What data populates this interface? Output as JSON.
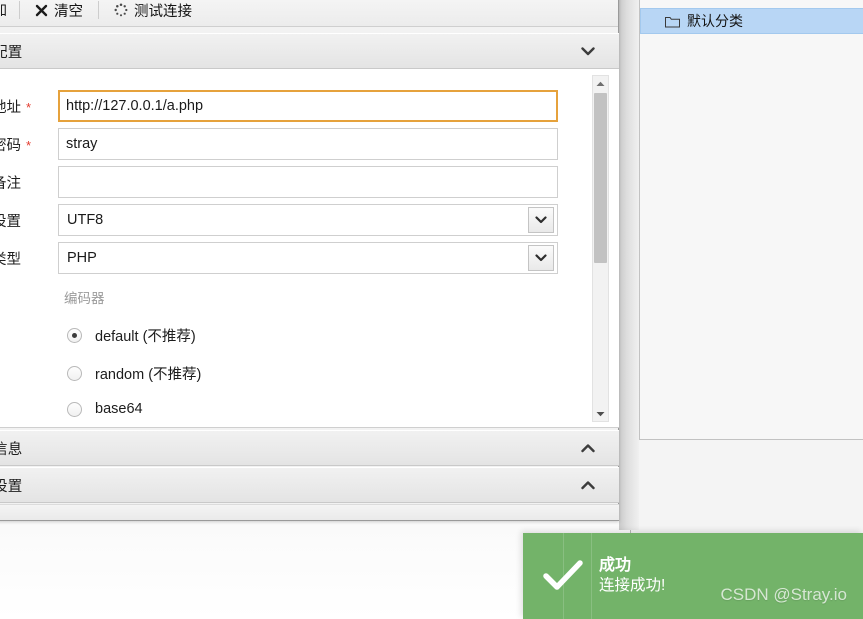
{
  "toolbar": {
    "truncated_label": "加",
    "buttons": [
      {
        "label": "清空",
        "icon": "clear-x-icon"
      },
      {
        "label": "测试连接",
        "icon": "spinner-dots-icon"
      }
    ]
  },
  "sections": {
    "base": {
      "title": "配置",
      "chevron": "chevron-down-icon"
    },
    "request": {
      "title": "信息",
      "chevron": "chevron-up-icon"
    },
    "other": {
      "title": "设置",
      "chevron": "chevron-up-icon"
    }
  },
  "form": {
    "fields": [
      {
        "label": "地址",
        "required": true,
        "type": "text",
        "value": "http://127.0.0.1/a.php",
        "placeholder": "",
        "focused": true
      },
      {
        "label": "密码",
        "required": true,
        "type": "text",
        "value": "stray",
        "placeholder": "",
        "focused": false
      },
      {
        "label": "备注",
        "required": false,
        "type": "text",
        "value": "",
        "placeholder": "",
        "focused": false
      },
      {
        "label": "设置",
        "required": false,
        "type": "select",
        "value": "UTF8",
        "options": [
          "UTF8"
        ]
      },
      {
        "label": "类型",
        "required": false,
        "type": "select",
        "value": "PHP",
        "options": [
          "PHP"
        ]
      }
    ],
    "encoder_group_title": "编码器",
    "encoders": [
      {
        "label": "default (不推荐)",
        "selected": true
      },
      {
        "label": "random (不推荐)",
        "selected": false
      },
      {
        "label": "base64",
        "selected": false
      }
    ]
  },
  "scrollbar": {
    "up_icon": "scroll-up-arrow-icon",
    "down_icon": "scroll-down-arrow-icon"
  },
  "tree": {
    "items": [
      {
        "label": "默认分类",
        "icon": "folder-icon",
        "selected": true
      }
    ]
  },
  "toast": {
    "icon": "check-mark-icon",
    "title": "成功",
    "message": "连接成功!",
    "color": "#73b369"
  },
  "watermark": {
    "text": "CSDN @Stray.io"
  },
  "colors": {
    "accent_focus": "#e6a23c",
    "required_star": "#e23b2e",
    "tree_selection": "#b8d6f5",
    "toast_green": "#73b369"
  }
}
